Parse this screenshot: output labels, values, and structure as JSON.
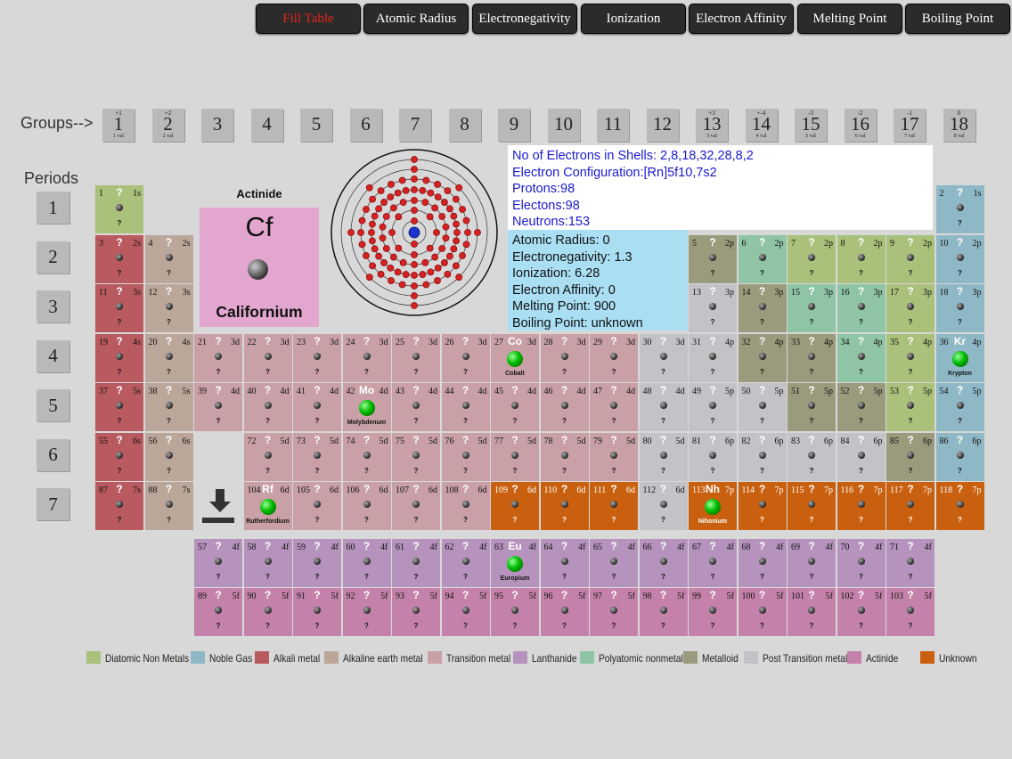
{
  "toolbar": {
    "buttons": [
      "Fill Table",
      "Atomic Radius",
      "Electronegativity",
      "Ionization",
      "Electron Affinity",
      "Melting Point",
      "Boiling Point"
    ]
  },
  "headers": {
    "groups": "Groups-->",
    "periods": "Periods"
  },
  "groups": [
    {
      "n": "1",
      "ox": "+1",
      "val": "1 val"
    },
    {
      "n": "2",
      "ox": "+2",
      "val": "2 val"
    },
    {
      "n": "3",
      "ox": "",
      "val": ""
    },
    {
      "n": "4",
      "ox": "",
      "val": ""
    },
    {
      "n": "5",
      "ox": "",
      "val": ""
    },
    {
      "n": "6",
      "ox": "",
      "val": ""
    },
    {
      "n": "7",
      "ox": "",
      "val": ""
    },
    {
      "n": "8",
      "ox": "",
      "val": ""
    },
    {
      "n": "9",
      "ox": "",
      "val": ""
    },
    {
      "n": "10",
      "ox": "",
      "val": ""
    },
    {
      "n": "11",
      "ox": "",
      "val": ""
    },
    {
      "n": "12",
      "ox": "",
      "val": ""
    },
    {
      "n": "13",
      "ox": "+3",
      "val": "3 val"
    },
    {
      "n": "14",
      "ox": "+-4",
      "val": "4 val"
    },
    {
      "n": "15",
      "ox": "-3",
      "val": "5 val"
    },
    {
      "n": "16",
      "ox": "-2",
      "val": "6 val"
    },
    {
      "n": "17",
      "ox": "-1",
      "val": "7 val"
    },
    {
      "n": "18",
      "ox": "0",
      "val": "8 val"
    }
  ],
  "periods": [
    "1",
    "2",
    "3",
    "4",
    "5",
    "6",
    "7"
  ],
  "selected": {
    "category": "Actinide",
    "symbol": "Cf",
    "name": "Californium",
    "shells": "No of Electrons in Shells: 2,8,18,32,28,8,2",
    "config": "Electron Configuration:[Rn]5f10,7s2",
    "protons": "Protons:98",
    "electrons": "Electons:98",
    "neutrons": "Neutrons:153",
    "atomic_radius": "Atomic Radius: 0",
    "electronegativity": "Electronegativity: 1.3",
    "ionization": "Ionization: 6.28",
    "electron_affinity": "Electron Affinity: 0",
    "melting_point": "Melting Point: 900",
    "boiling_point": "Boiling Point: unknown"
  },
  "colors": {
    "diatomic": "#a9c17b",
    "noble": "#8fb8c6",
    "alkali": "#b85a5f",
    "alkaline": "#bba79a",
    "transition": "#c8a0a6",
    "lanthanide": "#b693bd",
    "polyatomic": "#8fc5a4",
    "metalloid": "#9a9a7c",
    "post": "#c3c3c7",
    "actinide": "#c482aa",
    "unknown": "#c9600f",
    "selected_bg": "#e2a6cf"
  },
  "elements": [
    {
      "n": 1,
      "o": "1s",
      "c": "diatomic",
      "r": 0,
      "col": 0
    },
    {
      "n": 2,
      "o": "1s",
      "c": "noble",
      "r": 0,
      "col": 17
    },
    {
      "n": 3,
      "o": "2s",
      "c": "alkali",
      "r": 1,
      "col": 0
    },
    {
      "n": 4,
      "o": "2s",
      "c": "alkaline",
      "r": 1,
      "col": 1
    },
    {
      "n": 5,
      "o": "2p",
      "c": "metalloid",
      "r": 1,
      "col": 12
    },
    {
      "n": 6,
      "o": "2p",
      "c": "polyatomic",
      "r": 1,
      "col": 13
    },
    {
      "n": 7,
      "o": "2p",
      "c": "diatomic",
      "r": 1,
      "col": 14
    },
    {
      "n": 8,
      "o": "2p",
      "c": "diatomic",
      "r": 1,
      "col": 15
    },
    {
      "n": 9,
      "o": "2p",
      "c": "diatomic",
      "r": 1,
      "col": 16
    },
    {
      "n": 10,
      "o": "2p",
      "c": "noble",
      "r": 1,
      "col": 17
    },
    {
      "n": 11,
      "o": "3s",
      "c": "alkali",
      "r": 2,
      "col": 0
    },
    {
      "n": 12,
      "o": "3s",
      "c": "alkaline",
      "r": 2,
      "col": 1
    },
    {
      "n": 13,
      "o": "3p",
      "c": "post",
      "r": 2,
      "col": 12
    },
    {
      "n": 14,
      "o": "3p",
      "c": "metalloid",
      "r": 2,
      "col": 13
    },
    {
      "n": 15,
      "o": "3p",
      "c": "polyatomic",
      "r": 2,
      "col": 14
    },
    {
      "n": 16,
      "o": "3p",
      "c": "polyatomic",
      "r": 2,
      "col": 15
    },
    {
      "n": 17,
      "o": "3p",
      "c": "diatomic",
      "r": 2,
      "col": 16
    },
    {
      "n": 18,
      "o": "3p",
      "c": "noble",
      "r": 2,
      "col": 17
    },
    {
      "n": 19,
      "o": "4s",
      "c": "alkali",
      "r": 3,
      "col": 0
    },
    {
      "n": 20,
      "o": "4s",
      "c": "alkaline",
      "r": 3,
      "col": 1
    },
    {
      "n": 21,
      "o": "3d",
      "c": "transition",
      "r": 3,
      "col": 2
    },
    {
      "n": 22,
      "o": "3d",
      "c": "transition",
      "r": 3,
      "col": 3
    },
    {
      "n": 23,
      "o": "3d",
      "c": "transition",
      "r": 3,
      "col": 4
    },
    {
      "n": 24,
      "o": "3d",
      "c": "transition",
      "r": 3,
      "col": 5
    },
    {
      "n": 25,
      "o": "3d",
      "c": "transition",
      "r": 3,
      "col": 6
    },
    {
      "n": 26,
      "o": "3d",
      "c": "transition",
      "r": 3,
      "col": 7
    },
    {
      "n": 27,
      "o": "3d",
      "c": "transition",
      "r": 3,
      "col": 8,
      "sym": "Co",
      "name": "Cobalt"
    },
    {
      "n": 28,
      "o": "3d",
      "c": "transition",
      "r": 3,
      "col": 9
    },
    {
      "n": 29,
      "o": "3d",
      "c": "transition",
      "r": 3,
      "col": 10
    },
    {
      "n": 30,
      "o": "3d",
      "c": "post",
      "r": 3,
      "col": 11
    },
    {
      "n": 31,
      "o": "4p",
      "c": "post",
      "r": 3,
      "col": 12
    },
    {
      "n": 32,
      "o": "4p",
      "c": "metalloid",
      "r": 3,
      "col": 13
    },
    {
      "n": 33,
      "o": "4p",
      "c": "metalloid",
      "r": 3,
      "col": 14
    },
    {
      "n": 34,
      "o": "4p",
      "c": "polyatomic",
      "r": 3,
      "col": 15
    },
    {
      "n": 35,
      "o": "4p",
      "c": "diatomic",
      "r": 3,
      "col": 16
    },
    {
      "n": 36,
      "o": "4p",
      "c": "noble",
      "r": 3,
      "col": 17,
      "sym": "Kr",
      "name": "Krypton"
    },
    {
      "n": 37,
      "o": "5s",
      "c": "alkali",
      "r": 4,
      "col": 0
    },
    {
      "n": 38,
      "o": "5s",
      "c": "alkaline",
      "r": 4,
      "col": 1
    },
    {
      "n": 39,
      "o": "4d",
      "c": "transition",
      "r": 4,
      "col": 2
    },
    {
      "n": 40,
      "o": "4d",
      "c": "transition",
      "r": 4,
      "col": 3
    },
    {
      "n": 41,
      "o": "4d",
      "c": "transition",
      "r": 4,
      "col": 4
    },
    {
      "n": 42,
      "o": "4d",
      "c": "transition",
      "r": 4,
      "col": 5,
      "sym": "Mo",
      "name": "Molybdenum"
    },
    {
      "n": 43,
      "o": "4d",
      "c": "transition",
      "r": 4,
      "col": 6
    },
    {
      "n": 44,
      "o": "4d",
      "c": "transition",
      "r": 4,
      "col": 7
    },
    {
      "n": 45,
      "o": "4d",
      "c": "transition",
      "r": 4,
      "col": 8
    },
    {
      "n": 46,
      "o": "4d",
      "c": "transition",
      "r": 4,
      "col": 9
    },
    {
      "n": 47,
      "o": "4d",
      "c": "transition",
      "r": 4,
      "col": 10
    },
    {
      "n": 48,
      "o": "4d",
      "c": "post",
      "r": 4,
      "col": 11
    },
    {
      "n": 49,
      "o": "5p",
      "c": "post",
      "r": 4,
      "col": 12
    },
    {
      "n": 50,
      "o": "5p",
      "c": "post",
      "r": 4,
      "col": 13
    },
    {
      "n": 51,
      "o": "5p",
      "c": "metalloid",
      "r": 4,
      "col": 14
    },
    {
      "n": 52,
      "o": "5p",
      "c": "metalloid",
      "r": 4,
      "col": 15
    },
    {
      "n": 53,
      "o": "5p",
      "c": "diatomic",
      "r": 4,
      "col": 16
    },
    {
      "n": 54,
      "o": "5p",
      "c": "noble",
      "r": 4,
      "col": 17
    },
    {
      "n": 55,
      "o": "6s",
      "c": "alkali",
      "r": 5,
      "col": 0
    },
    {
      "n": 56,
      "o": "6s",
      "c": "alkaline",
      "r": 5,
      "col": 1
    },
    {
      "n": 72,
      "o": "5d",
      "c": "transition",
      "r": 5,
      "col": 3
    },
    {
      "n": 73,
      "o": "5d",
      "c": "transition",
      "r": 5,
      "col": 4
    },
    {
      "n": 74,
      "o": "5d",
      "c": "transition",
      "r": 5,
      "col": 5
    },
    {
      "n": 75,
      "o": "5d",
      "c": "transition",
      "r": 5,
      "col": 6
    },
    {
      "n": 76,
      "o": "5d",
      "c": "transition",
      "r": 5,
      "col": 7
    },
    {
      "n": 77,
      "o": "5d",
      "c": "transition",
      "r": 5,
      "col": 8
    },
    {
      "n": 78,
      "o": "5d",
      "c": "transition",
      "r": 5,
      "col": 9
    },
    {
      "n": 79,
      "o": "5d",
      "c": "transition",
      "r": 5,
      "col": 10
    },
    {
      "n": 80,
      "o": "5d",
      "c": "post",
      "r": 5,
      "col": 11
    },
    {
      "n": 81,
      "o": "6p",
      "c": "post",
      "r": 5,
      "col": 12
    },
    {
      "n": 82,
      "o": "6p",
      "c": "post",
      "r": 5,
      "col": 13
    },
    {
      "n": 83,
      "o": "6p",
      "c": "post",
      "r": 5,
      "col": 14
    },
    {
      "n": 84,
      "o": "6p",
      "c": "post",
      "r": 5,
      "col": 15
    },
    {
      "n": 85,
      "o": "6p",
      "c": "metalloid",
      "r": 5,
      "col": 16
    },
    {
      "n": 86,
      "o": "6p",
      "c": "noble",
      "r": 5,
      "col": 17
    },
    {
      "n": 87,
      "o": "7s",
      "c": "alkali",
      "r": 6,
      "col": 0
    },
    {
      "n": 88,
      "o": "7s",
      "c": "alkaline",
      "r": 6,
      "col": 1
    },
    {
      "n": 104,
      "o": "6d",
      "c": "transition",
      "r": 6,
      "col": 3,
      "sym": "Rf",
      "name": "Rutherfordium"
    },
    {
      "n": 105,
      "o": "6d",
      "c": "transition",
      "r": 6,
      "col": 4
    },
    {
      "n": 106,
      "o": "6d",
      "c": "transition",
      "r": 6,
      "col": 5
    },
    {
      "n": 107,
      "o": "6d",
      "c": "transition",
      "r": 6,
      "col": 6
    },
    {
      "n": 108,
      "o": "6d",
      "c": "transition",
      "r": 6,
      "col": 7
    },
    {
      "n": 109,
      "o": "6d",
      "c": "unknown",
      "r": 6,
      "col": 8
    },
    {
      "n": 110,
      "o": "6d",
      "c": "unknown",
      "r": 6,
      "col": 9
    },
    {
      "n": 111,
      "o": "6d",
      "c": "unknown",
      "r": 6,
      "col": 10
    },
    {
      "n": 112,
      "o": "6d",
      "c": "post",
      "r": 6,
      "col": 11
    },
    {
      "n": 113,
      "o": "7p",
      "c": "unknown",
      "r": 6,
      "col": 12,
      "sym": "Nh",
      "name": "Nihonium"
    },
    {
      "n": 114,
      "o": "7p",
      "c": "unknown",
      "r": 6,
      "col": 13
    },
    {
      "n": 115,
      "o": "7p",
      "c": "unknown",
      "r": 6,
      "col": 14
    },
    {
      "n": 116,
      "o": "7p",
      "c": "unknown",
      "r": 6,
      "col": 15
    },
    {
      "n": 117,
      "o": "7p",
      "c": "unknown",
      "r": 6,
      "col": 16
    },
    {
      "n": 118,
      "o": "7p",
      "c": "unknown",
      "r": 6,
      "col": 17
    },
    {
      "n": 57,
      "o": "4f",
      "c": "lanthanide",
      "r": 7,
      "col": 2
    },
    {
      "n": 58,
      "o": "4f",
      "c": "lanthanide",
      "r": 7,
      "col": 3
    },
    {
      "n": 59,
      "o": "4f",
      "c": "lanthanide",
      "r": 7,
      "col": 4
    },
    {
      "n": 60,
      "o": "4f",
      "c": "lanthanide",
      "r": 7,
      "col": 5
    },
    {
      "n": 61,
      "o": "4f",
      "c": "lanthanide",
      "r": 7,
      "col": 6
    },
    {
      "n": 62,
      "o": "4f",
      "c": "lanthanide",
      "r": 7,
      "col": 7
    },
    {
      "n": 63,
      "o": "4f",
      "c": "lanthanide",
      "r": 7,
      "col": 8,
      "sym": "Eu",
      "name": "Europium"
    },
    {
      "n": 64,
      "o": "4f",
      "c": "lanthanide",
      "r": 7,
      "col": 9
    },
    {
      "n": 65,
      "o": "4f",
      "c": "lanthanide",
      "r": 7,
      "col": 10
    },
    {
      "n": 66,
      "o": "4f",
      "c": "lanthanide",
      "r": 7,
      "col": 11
    },
    {
      "n": 67,
      "o": "4f",
      "c": "lanthanide",
      "r": 7,
      "col": 12
    },
    {
      "n": 68,
      "o": "4f",
      "c": "lanthanide",
      "r": 7,
      "col": 13
    },
    {
      "n": 69,
      "o": "4f",
      "c": "lanthanide",
      "r": 7,
      "col": 14
    },
    {
      "n": 70,
      "o": "4f",
      "c": "lanthanide",
      "r": 7,
      "col": 15
    },
    {
      "n": 71,
      "o": "4f",
      "c": "lanthanide",
      "r": 7,
      "col": 16
    },
    {
      "n": 89,
      "o": "5f",
      "c": "actinide",
      "r": 8,
      "col": 2
    },
    {
      "n": 90,
      "o": "5f",
      "c": "actinide",
      "r": 8,
      "col": 3
    },
    {
      "n": 91,
      "o": "5f",
      "c": "actinide",
      "r": 8,
      "col": 4
    },
    {
      "n": 92,
      "o": "5f",
      "c": "actinide",
      "r": 8,
      "col": 5
    },
    {
      "n": 93,
      "o": "5f",
      "c": "actinide",
      "r": 8,
      "col": 6
    },
    {
      "n": 94,
      "o": "5f",
      "c": "actinide",
      "r": 8,
      "col": 7
    },
    {
      "n": 95,
      "o": "5f",
      "c": "actinide",
      "r": 8,
      "col": 8
    },
    {
      "n": 96,
      "o": "5f",
      "c": "actinide",
      "r": 8,
      "col": 9
    },
    {
      "n": 97,
      "o": "5f",
      "c": "actinide",
      "r": 8,
      "col": 10
    },
    {
      "n": 98,
      "o": "5f",
      "c": "actinide",
      "r": 8,
      "col": 11
    },
    {
      "n": 99,
      "o": "5f",
      "c": "actinide",
      "r": 8,
      "col": 12
    },
    {
      "n": 100,
      "o": "5f",
      "c": "actinide",
      "r": 8,
      "col": 13
    },
    {
      "n": 101,
      "o": "5f",
      "c": "actinide",
      "r": 8,
      "col": 14
    },
    {
      "n": 102,
      "o": "5f",
      "c": "actinide",
      "r": 8,
      "col": 15
    },
    {
      "n": 103,
      "o": "5f",
      "c": "actinide",
      "r": 8,
      "col": 16
    }
  ],
  "legend": [
    {
      "label": "Diatomic Non Metals",
      "c": "diatomic"
    },
    {
      "label": "Noble Gas",
      "c": "noble"
    },
    {
      "label": "Alkali metal",
      "c": "alkali"
    },
    {
      "label": "Alkaline earth metal",
      "c": "alkaline"
    },
    {
      "label": "Transition metal",
      "c": "transition"
    },
    {
      "label": "Lanthanide",
      "c": "lanthanide"
    },
    {
      "label": "Polyatomic nonmetal",
      "c": "polyatomic"
    },
    {
      "label": "Metalloid",
      "c": "metalloid"
    },
    {
      "label": "Post Transition metal",
      "c": "post"
    },
    {
      "label": "Actinide",
      "c": "actinide"
    },
    {
      "label": "Unknown",
      "c": "unknown"
    }
  ]
}
